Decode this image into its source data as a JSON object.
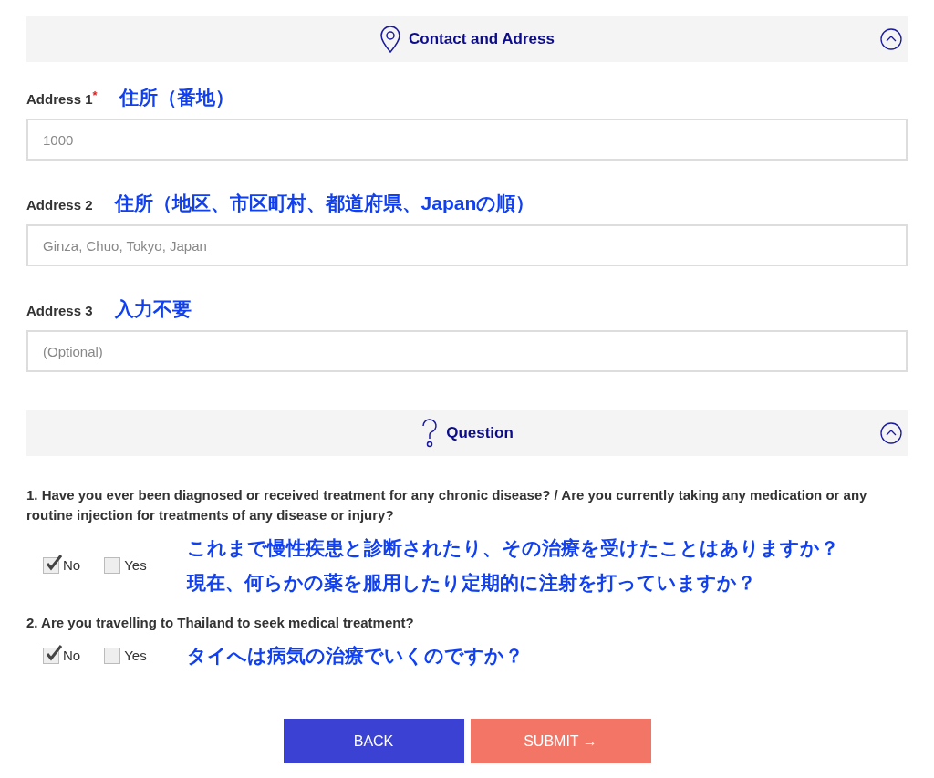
{
  "sections": [
    {
      "kind": "address",
      "title": "Contact and Adress",
      "expanded": true,
      "fields": [
        {
          "label": "Address 1",
          "required_mark": "*",
          "note": "住所（番地）",
          "placeholder": "1000"
        },
        {
          "label": "Address 2",
          "note": "住所（地区、市区町村、都道府県、Japanの順）",
          "placeholder": "Ginza, Chuo, Tokyo, Japan"
        },
        {
          "label": "Address 3",
          "note": "入力不要",
          "placeholder": "(Optional)"
        }
      ]
    },
    {
      "kind": "question",
      "title": "Question",
      "expanded": true,
      "questions": [
        {
          "text": "1. Have you ever been diagnosed or received treatment for any chronic disease? / Are you currently taking any medication or any routine injection for treatments of any disease or injury?",
          "options": [
            {
              "label": "No",
              "checked": true
            },
            {
              "label": "Yes",
              "checked": false
            }
          ],
          "notes": [
            "これまで慢性疾患と診断されたり、その治療を受けたことはありますか？",
            "現在、何らかの薬を服用したり定期的に注射を打っていますか？"
          ]
        },
        {
          "text": "2. Are you travelling to Thailand to seek medical treatment?",
          "options": [
            {
              "label": "No",
              "checked": true
            },
            {
              "label": "Yes",
              "checked": false
            }
          ],
          "notes": [
            "タイへは病気の治療でいくのですか？"
          ]
        }
      ]
    }
  ],
  "buttons": [
    {
      "kind": "back",
      "label": "BACK"
    },
    {
      "kind": "submit",
      "label": "SUBMIT →"
    }
  ]
}
